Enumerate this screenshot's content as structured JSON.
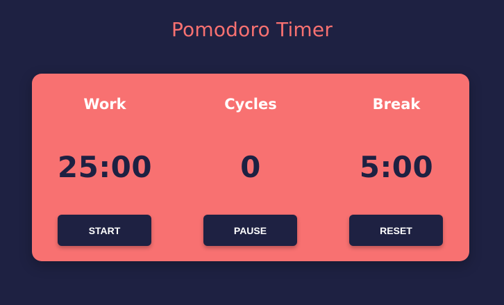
{
  "app": {
    "title": "Pomodoro Timer"
  },
  "panels": [
    {
      "label": "Work",
      "value": "25:00",
      "button": "START"
    },
    {
      "label": "Cycles",
      "value": "0",
      "button": "PAUSE"
    },
    {
      "label": "Break",
      "value": "5:00",
      "button": "RESET"
    }
  ],
  "colors": {
    "background": "#1e2142",
    "accent": "#f87171",
    "text_light": "#ffffff",
    "text_dark": "#1e2142"
  }
}
